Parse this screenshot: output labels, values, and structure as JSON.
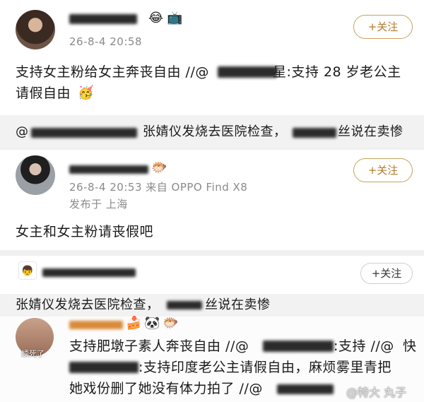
{
  "post1": {
    "time": "26-8-4 20:58",
    "follow": "+关注",
    "text_line1": "支持女主粉给女主奔丧自由 //@",
    "text_line1b": "星:支持 28 岁老公主",
    "text_line2": "请假自由",
    "quote_prefix": "@",
    "quote_mid": "张婧仪发烧去医院检查，",
    "quote_end": "丝说在卖惨"
  },
  "post2": {
    "time_source": "26-8-4 20:53  来自 OPPO Find X8",
    "location": "发布于 上海",
    "follow": "+关注",
    "text": "女主和女主粉请丧假吧"
  },
  "post3": {
    "follow": "+关注",
    "quote_text": "张婧仪发烧去医院检查，",
    "quote_end": "丝说在卖惨",
    "avatar_label": "烦死了",
    "text_line1": "支持肥墩子素人奔丧自由 //@",
    "text_line1b": ":支持 //@",
    "text_line1c": "快",
    "text_line2": ":支持印度老公主请假自由，麻烦雾里青把",
    "text_line3": "她戏份删了她没有体力拍了 //@"
  },
  "watermark": "@特大 丸子",
  "icons": {
    "emoji_laugh": "😂",
    "emoji_tv": "📺",
    "emoji_bounce": "🥳",
    "emoji_rabbit": "🐱",
    "emoji_panda": "🐼",
    "emoji_fish": "🐡",
    "emoji_cake": "🍰"
  }
}
